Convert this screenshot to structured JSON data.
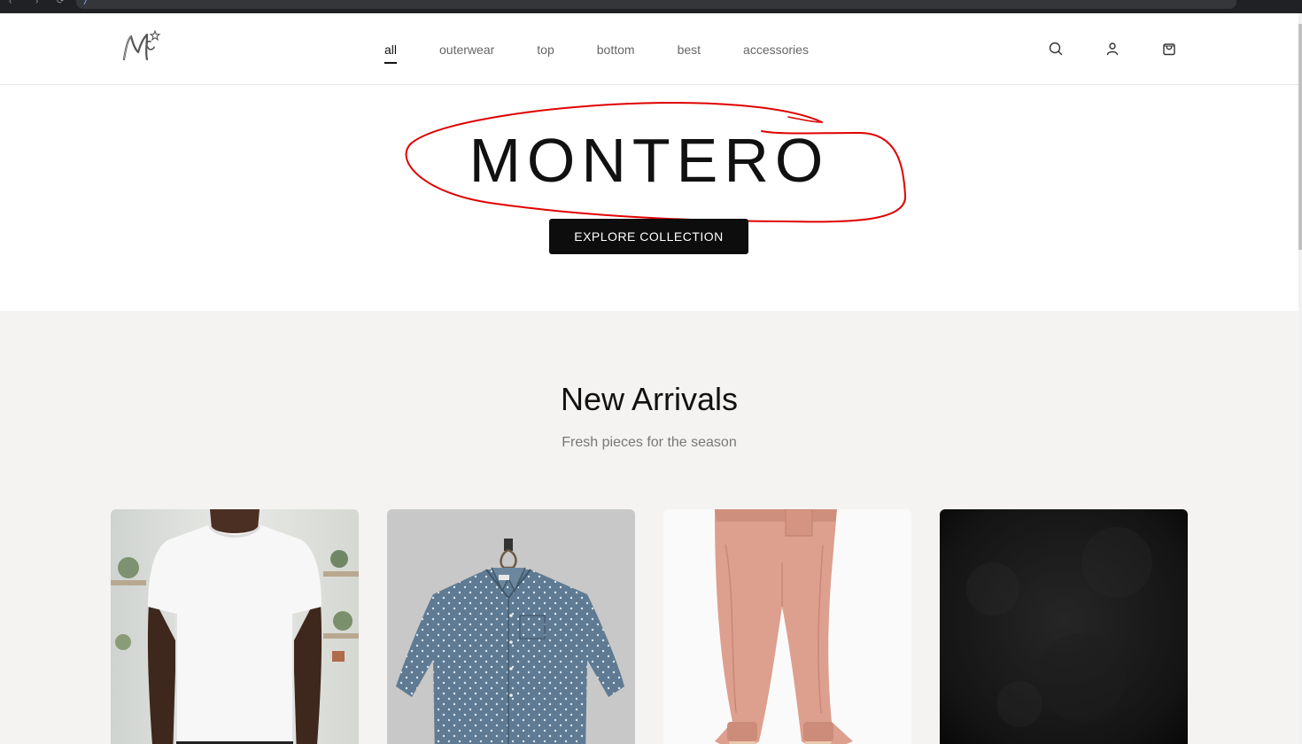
{
  "browser": {
    "url_fragment": "/",
    "back_glyph": "‹",
    "forward_glyph": "›",
    "reload_glyph": "⟳"
  },
  "header": {
    "logo_alt": "M",
    "nav": [
      {
        "label": "all",
        "active": true
      },
      {
        "label": "outerwear",
        "active": false
      },
      {
        "label": "top",
        "active": false
      },
      {
        "label": "bottom",
        "active": false
      },
      {
        "label": "best",
        "active": false
      },
      {
        "label": "accessories",
        "active": false
      }
    ],
    "icons": [
      "search-icon",
      "user-icon",
      "cart-icon"
    ]
  },
  "hero": {
    "title": "MONTERO",
    "cta_label": "EXPLORE COLLECTION",
    "annotation_color": "#e00000"
  },
  "arrivals": {
    "title": "New Arrivals",
    "subtitle": "Fresh pieces for the season",
    "products": [
      {
        "name": "white-tshirt",
        "depicts": "man in white t-shirt"
      },
      {
        "name": "denim-shirt",
        "depicts": "blue polka-dot denim shirt on hanger"
      },
      {
        "name": "pink-joggers",
        "depicts": "pink satin jogger pants"
      },
      {
        "name": "black-item",
        "depicts": "dark textured image"
      }
    ]
  },
  "colors": {
    "accent": "#0d0d0d",
    "section_bg": "#f4f3f1",
    "nav_text": "#666666"
  }
}
